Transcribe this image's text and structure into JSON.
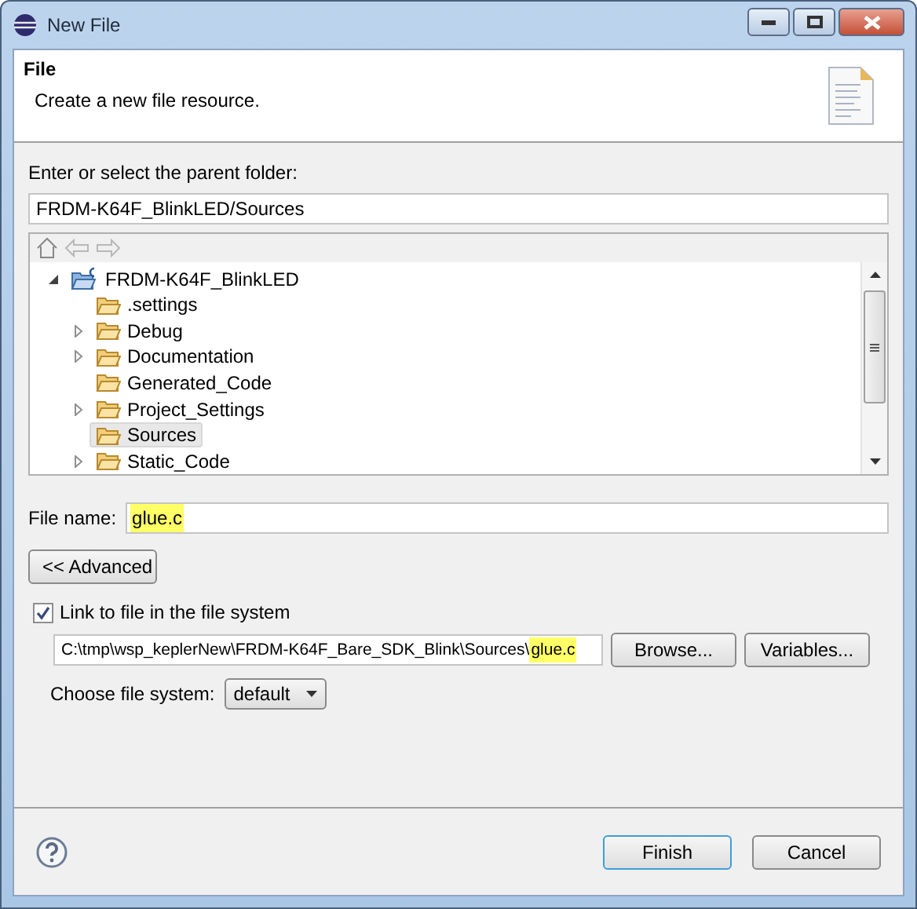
{
  "window": {
    "title": "New File"
  },
  "header": {
    "title": "File",
    "description": "Create a new file resource."
  },
  "parent_folder": {
    "label": "Enter or select the parent folder:",
    "value": "FRDM-K64F_BlinkLED/Sources"
  },
  "tree": [
    {
      "label": "FRDM-K64F_BlinkLED",
      "kind": "project",
      "expanded": true,
      "selected": false,
      "children": [
        {
          "label": ".settings",
          "kind": "folder",
          "expandable": false,
          "selected": false
        },
        {
          "label": "Debug",
          "kind": "folder",
          "expandable": true,
          "selected": false
        },
        {
          "label": "Documentation",
          "kind": "folder",
          "expandable": true,
          "selected": false
        },
        {
          "label": "Generated_Code",
          "kind": "folder",
          "expandable": false,
          "selected": false
        },
        {
          "label": "Project_Settings",
          "kind": "folder",
          "expandable": true,
          "selected": false
        },
        {
          "label": "Sources",
          "kind": "folder",
          "expandable": false,
          "selected": true
        },
        {
          "label": "Static_Code",
          "kind": "folder",
          "expandable": true,
          "selected": false
        }
      ]
    }
  ],
  "file_name": {
    "label": "File name:",
    "value": "glue.c",
    "highlight": true
  },
  "advanced_button": "<< Advanced",
  "link": {
    "label": "Link to file in the file system",
    "checked": true,
    "path": "C:\\tmp\\wsp_keplerNew\\FRDM-K64F_Bare_SDK_Blink\\Sources\\glue.c",
    "highlight": true,
    "browse": "Browse...",
    "variables": "Variables..."
  },
  "file_system": {
    "label": "Choose file system:",
    "value": "default"
  },
  "buttons": {
    "finish": "Finish",
    "cancel": "Cancel"
  }
}
